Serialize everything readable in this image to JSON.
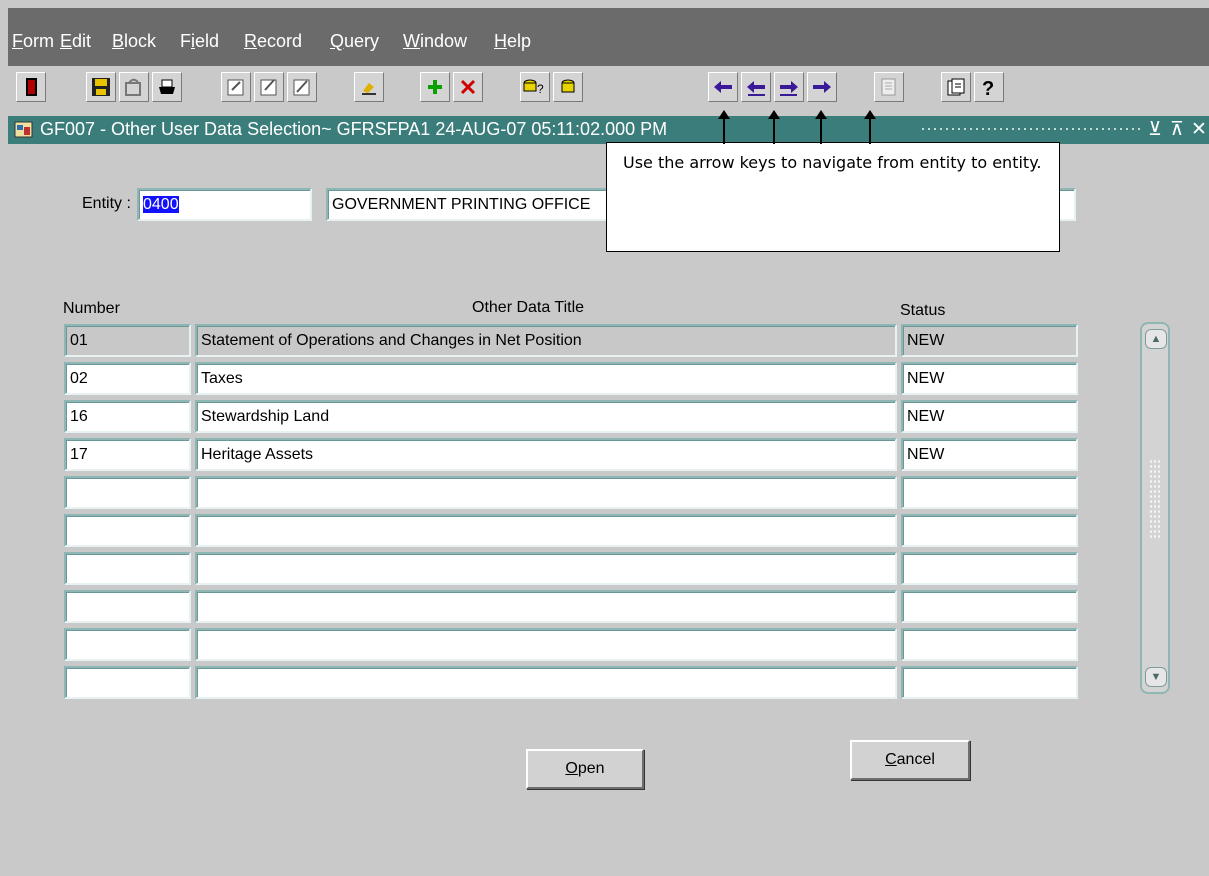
{
  "menu": {
    "items": [
      {
        "key": "F",
        "rest": "orm"
      },
      {
        "key": "E",
        "rest": "dit"
      },
      {
        "key": "B",
        "rest": "lock"
      },
      {
        "key": "Fi",
        "rest": "eld",
        "underline_index": 1
      },
      {
        "key": "R",
        "rest": "ecord"
      },
      {
        "key": "Q",
        "rest": "uery"
      },
      {
        "key": "W",
        "rest": "indow"
      },
      {
        "key": "H",
        "rest": "elp"
      }
    ]
  },
  "toolbar": {
    "buttons": [
      {
        "icon": "exit-icon",
        "color": "#b00000"
      },
      {
        "icon": "save-icon",
        "color": "#d8b100"
      },
      {
        "icon": "rollback-icon",
        "color": "#5b5b5b"
      },
      {
        "icon": "print-icon",
        "color": "#000000"
      },
      {
        "icon": "clear-field-icon",
        "color": "#4c4c4c"
      },
      {
        "icon": "clear-record-icon",
        "color": "#4c4c4c"
      },
      {
        "icon": "clear-block-icon",
        "color": "#4c4c4c"
      },
      {
        "icon": "edit-icon",
        "color": "#b88a00"
      },
      {
        "icon": "insert-record-icon",
        "color": "#0aa000"
      },
      {
        "icon": "remove-record-icon",
        "color": "#d10000"
      },
      {
        "icon": "enter-query-icon",
        "color": "#6b6b00"
      },
      {
        "icon": "execute-query-icon",
        "color": "#6b6b00"
      },
      {
        "icon": "previous-block-icon",
        "color": "#3b1a9a"
      },
      {
        "icon": "previous-record-icon",
        "color": "#3b1a9a"
      },
      {
        "icon": "next-record-icon",
        "color": "#3b1a9a"
      },
      {
        "icon": "next-block-icon",
        "color": "#3b1a9a"
      },
      {
        "icon": "list-icon",
        "color": "#9aa0a0"
      },
      {
        "icon": "options-icon",
        "color": "#333333"
      },
      {
        "icon": "help-icon",
        "color": "#000000"
      }
    ]
  },
  "window": {
    "title": "GF007 - Other User Data Selection~ GFRSFPA1  24-AUG-07 05:11:02.000 PM",
    "minimize": "⊻",
    "maximize": "⊼",
    "close": "✕"
  },
  "entity": {
    "label": "Entity :",
    "code": "0400",
    "name": "GOVERNMENT PRINTING OFFICE"
  },
  "table": {
    "headers": {
      "number": "Number",
      "title": "Other Data Title",
      "status": "Status"
    },
    "rows": [
      {
        "number": "01",
        "title": "Statement of Operations and Changes in Net Position",
        "status": "NEW"
      },
      {
        "number": "02",
        "title": "Taxes",
        "status": "NEW"
      },
      {
        "number": "16",
        "title": "Stewardship Land",
        "status": "NEW"
      },
      {
        "number": "17",
        "title": "Heritage Assets",
        "status": "NEW"
      },
      {
        "number": "",
        "title": "",
        "status": ""
      },
      {
        "number": "",
        "title": "",
        "status": ""
      },
      {
        "number": "",
        "title": "",
        "status": ""
      },
      {
        "number": "",
        "title": "",
        "status": ""
      },
      {
        "number": "",
        "title": "",
        "status": ""
      },
      {
        "number": "",
        "title": "",
        "status": ""
      }
    ]
  },
  "buttons": {
    "open_key": "O",
    "open_rest": "pen",
    "cancel_key": "C",
    "cancel_rest": "ancel"
  },
  "callout": {
    "text": "Use the arrow keys to navigate from entity to entity."
  },
  "colors": {
    "menubar": "#6b6b6b",
    "titlebar": "#3a7d7b",
    "selection": "#1212ff"
  }
}
